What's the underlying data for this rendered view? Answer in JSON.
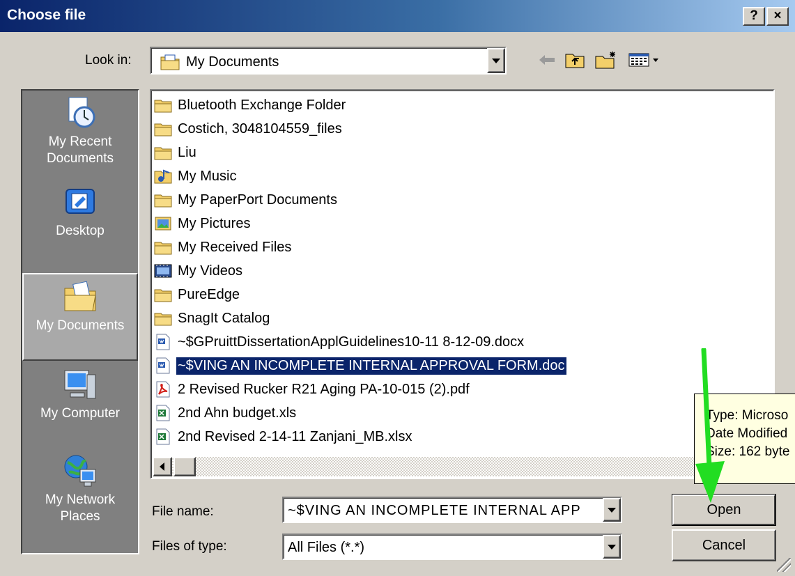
{
  "window": {
    "title": "Choose file",
    "help_label": "?",
    "close_label": "×"
  },
  "lookin": {
    "label": "Look in:",
    "value": "My Documents"
  },
  "places": [
    {
      "label": "My Recent Documents",
      "icon": "recent-documents-icon"
    },
    {
      "label": "Desktop",
      "icon": "desktop-icon"
    },
    {
      "label": "My Documents",
      "icon": "my-documents-icon"
    },
    {
      "label": "My Computer",
      "icon": "my-computer-icon"
    },
    {
      "label": "My Network Places",
      "icon": "network-places-icon"
    }
  ],
  "files": [
    {
      "name": "Bluetooth Exchange Folder",
      "icon": "folder-icon"
    },
    {
      "name": "Costich, 3048104559_files",
      "icon": "folder-icon"
    },
    {
      "name": "Liu",
      "icon": "folder-icon"
    },
    {
      "name": "My Music",
      "icon": "music-folder-icon"
    },
    {
      "name": "My PaperPort Documents",
      "icon": "folder-icon"
    },
    {
      "name": "My Pictures",
      "icon": "pictures-folder-icon"
    },
    {
      "name": "My Received Files",
      "icon": "folder-icon"
    },
    {
      "name": "My Videos",
      "icon": "videos-folder-icon"
    },
    {
      "name": "PureEdge",
      "icon": "folder-icon"
    },
    {
      "name": "SnagIt Catalog",
      "icon": "folder-icon"
    },
    {
      "name": "~$GPruittDissertationApplGuidelines10-11 8-12-09.docx",
      "icon": "word-doc-icon"
    },
    {
      "name": "~$VING AN INCOMPLETE INTERNAL APPROVAL FORM.doc",
      "icon": "word-doc-icon",
      "selected": true
    },
    {
      "name": "2 Revised Rucker R21 Aging PA-10-015 (2).pdf",
      "icon": "pdf-icon"
    },
    {
      "name": "2nd Ahn budget.xls",
      "icon": "excel-icon"
    },
    {
      "name": "2nd Revised 2-14-11 Zanjani_MB.xlsx",
      "icon": "excel-icon"
    }
  ],
  "tooltip": {
    "line1": "Type: Microso",
    "line2": "Date Modified",
    "line3": "Size: 162 byte"
  },
  "filename": {
    "label": "File name:",
    "value": "~$VING AN INCOMPLETE INTERNAL APP"
  },
  "filetype": {
    "label": "Files of type:",
    "value": "All Files (*.*)"
  },
  "buttons": {
    "open": "Open",
    "cancel": "Cancel"
  },
  "colors": {
    "title_bar": "#0a246a",
    "selection": "#0a246a",
    "annotation_arrow": "#22dd22",
    "places_bg": "#808080"
  }
}
